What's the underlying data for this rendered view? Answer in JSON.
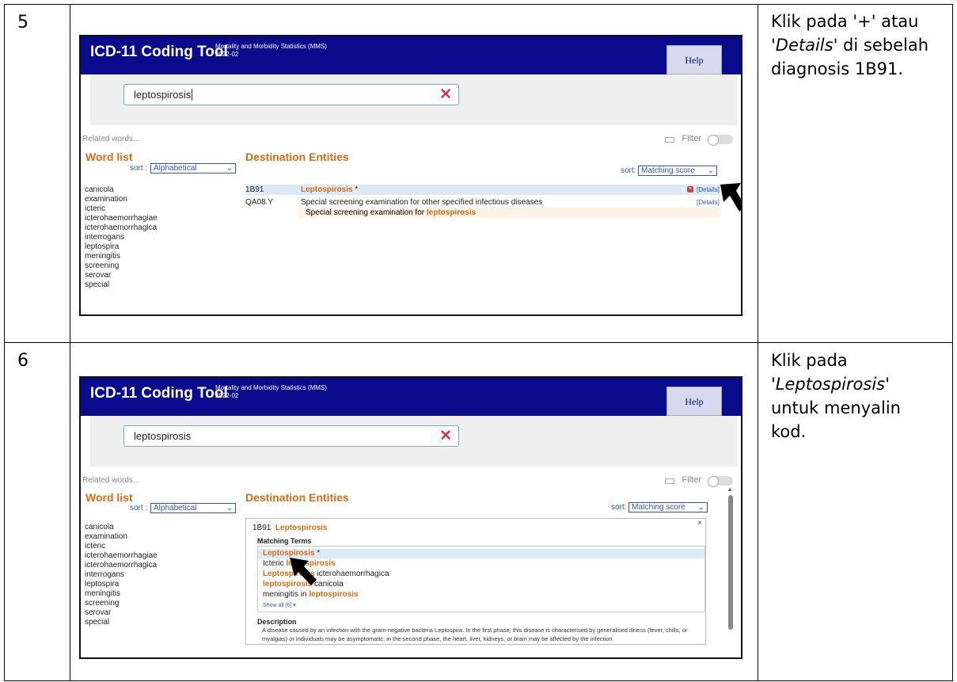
{
  "rows": [
    {
      "num": "5",
      "instruction": [
        {
          "t": "Klik pada '+' atau ",
          "i": false
        },
        {
          "t": "'Details'",
          "i": true
        },
        {
          "t": " di sebelah diagnosis 1B91.",
          "i": false
        }
      ]
    },
    {
      "num": "6",
      "instruction": [
        {
          "t": "Klik pada ",
          "i": false
        },
        {
          "t": "'Leptospirosis'",
          "i": true
        },
        {
          "t": " untuk menyalin kod.",
          "i": false
        }
      ]
    }
  ],
  "app": {
    "title": "ICD-11 Coding Tool",
    "mms_line1": "Mortality and Morbidity Statistics (MMS)",
    "mms_line2": "2022-02",
    "help": "Help"
  },
  "shot1": {
    "search_value": "leptospirosis",
    "clear": "✕"
  },
  "shot2": {
    "search_value": "leptospirosis",
    "clear": "✕"
  },
  "panel": {
    "related": "Related words...",
    "filter": "Filter",
    "word_list": "Word list",
    "sort_prefix": "sort :",
    "sort_alpha": "Alphabetical",
    "dest_entities": "Destination Entities",
    "sort_label": "sort:",
    "sort_match": "Matching score"
  },
  "word_list": [
    "canicola",
    "examination",
    "icteric",
    "icterohaemorrhagiae",
    "icterohaemorrhagica",
    "interrogans",
    "leptospira",
    "meningitis",
    "screening",
    "serovar",
    "special"
  ],
  "results": [
    {
      "code": "1B91",
      "title": "Leptospirosis",
      "suffix": " *",
      "details": "[Details]"
    },
    {
      "code": "QA08.Y",
      "title": "Special screening examination for other specified infectious diseases",
      "details": "[Details]",
      "sub_prefix": "Special screening examination for ",
      "sub_hl": "leptospirosis"
    }
  ],
  "card": {
    "code": "1B91",
    "title": "Leptospirosis",
    "close": "×",
    "matching_terms_label": "Matching Terms",
    "terms": [
      [
        {
          "t": "Leptospirosis",
          "h": true
        },
        {
          "t": " *",
          "h": false
        }
      ],
      [
        {
          "t": "Icteric ",
          "h": false
        },
        {
          "t": "leptospirosis",
          "h": true
        }
      ],
      [
        {
          "t": "Leptospirosis",
          "h": true
        },
        {
          "t": " icterohaemorrhagica",
          "h": false
        }
      ],
      [
        {
          "t": "leptospirosis",
          "h": true
        },
        {
          "t": " canicola",
          "h": false
        }
      ],
      [
        {
          "t": "meningitis in ",
          "h": false
        },
        {
          "t": "leptospirosis",
          "h": true
        }
      ]
    ],
    "show_all": "Show all [6] ▾",
    "description_label": "Description",
    "description": "A disease caused by an infection with the gram-negative bacteria Leptospira. In the first phase, this disease is characterised by generalised illness (fever, chills, or myalgias) or individuals may be asymptomatic; in the second phase, the heart, liver, kidneys, or brain may be affected by the infection"
  },
  "colors": {
    "header": "#0a0a8c",
    "accent": "#e06b12",
    "link": "#3355bb"
  },
  "icons": [
    "close-icon",
    "keyboard-icon",
    "chevron-down-icon",
    "cursor-arrow-icon",
    "scroll-up-icon"
  ]
}
